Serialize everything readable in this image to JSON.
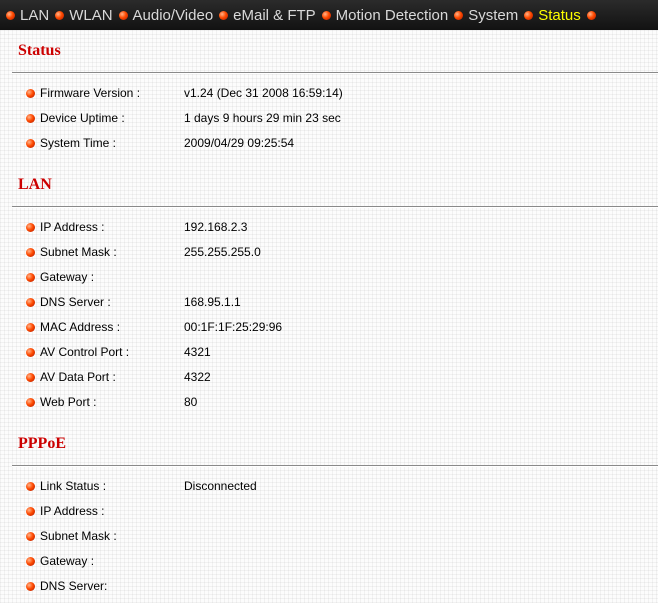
{
  "nav": {
    "items": [
      {
        "label": "LAN"
      },
      {
        "label": "WLAN"
      },
      {
        "label": "Audio/Video"
      },
      {
        "label": "eMail & FTP"
      },
      {
        "label": "Motion Detection"
      },
      {
        "label": "System"
      },
      {
        "label": "Status"
      }
    ],
    "active": "Status"
  },
  "status": {
    "title": "Status",
    "rows": [
      {
        "label": "Firmware Version :",
        "value": "v1.24 (Dec 31 2008 16:59:14)"
      },
      {
        "label": "Device Uptime :",
        "value": "1 days 9 hours 29 min 23 sec"
      },
      {
        "label": "System Time :",
        "value": "2009/04/29 09:25:54"
      }
    ]
  },
  "lan": {
    "title": "LAN",
    "rows": [
      {
        "label": "IP Address :",
        "value": "192.168.2.3"
      },
      {
        "label": "Subnet Mask :",
        "value": "255.255.255.0"
      },
      {
        "label": "Gateway :",
        "value": ""
      },
      {
        "label": "DNS Server :",
        "value": "168.95.1.1"
      },
      {
        "label": "MAC Address :",
        "value": "00:1F:1F:25:29:96"
      },
      {
        "label": "AV Control Port :",
        "value": "4321"
      },
      {
        "label": "AV Data Port :",
        "value": "4322"
      },
      {
        "label": "Web Port :",
        "value": "80"
      }
    ]
  },
  "pppoe": {
    "title": "PPPoE",
    "rows": [
      {
        "label": "Link Status :",
        "value": "Disconnected"
      },
      {
        "label": "IP Address :",
        "value": ""
      },
      {
        "label": "Subnet Mask :",
        "value": ""
      },
      {
        "label": "Gateway :",
        "value": ""
      },
      {
        "label": "DNS Server:",
        "value": ""
      }
    ]
  },
  "colors": {
    "section_title": "#cc0000",
    "nav_active": "#ffff00",
    "nav_text": "#d9d9d9",
    "bullet": "#ff4a00"
  },
  "icons": {
    "bullet": "orange-bullet-icon"
  }
}
